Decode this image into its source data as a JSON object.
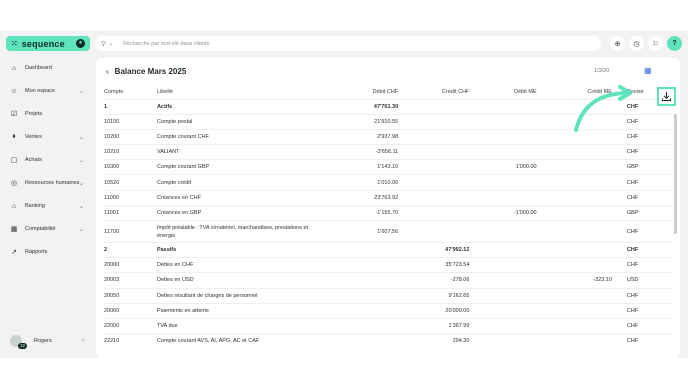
{
  "brand": {
    "name": "sequence",
    "mark": "⁙"
  },
  "search": {
    "placeholder": "Recherche par mot-clé dans clients"
  },
  "sidebar": {
    "items": [
      {
        "label": "Dashboard",
        "icon": "home-icon",
        "glyph": "⌂",
        "chevron": ""
      },
      {
        "label": "Mon espace",
        "icon": "user-icon",
        "glyph": "☺",
        "chevron": "⌄"
      },
      {
        "label": "Projets",
        "icon": "check-square-icon",
        "glyph": "☑",
        "chevron": ""
      },
      {
        "label": "Ventes",
        "icon": "tag-icon",
        "glyph": "⬧",
        "chevron": "⌄"
      },
      {
        "label": "Achats",
        "icon": "bag-icon",
        "glyph": "▢",
        "chevron": "⌄"
      },
      {
        "label": "Ressources humaines",
        "icon": "people-icon",
        "glyph": "◎",
        "chevron": "⌄"
      },
      {
        "label": "Banking",
        "icon": "bank-icon",
        "glyph": "⌂",
        "chevron": "⌄"
      },
      {
        "label": "Comptabilité",
        "icon": "calculator-icon",
        "glyph": "▦",
        "chevron": "⌄"
      },
      {
        "label": "Rapports",
        "icon": "chart-icon",
        "glyph": "↗",
        "chevron": ""
      }
    ],
    "user": {
      "name": "Rogers",
      "badge": "12"
    }
  },
  "page": {
    "title": "Balance Mars 2025",
    "date": "1/3/20"
  },
  "table": {
    "headers": [
      "Compte",
      "Libellé",
      "Débit CHF",
      "Crédit CHF",
      "Débit ME",
      "Crédit ME",
      "Devise"
    ],
    "rows": [
      {
        "compte": "1",
        "libelle": "Actifs",
        "debit_chf": "47'761.30",
        "credit_chf": "",
        "debit_me": "",
        "credit_me": "",
        "devise": "CHF",
        "group": true
      },
      {
        "compte": "10100",
        "libelle": "Compte postal",
        "debit_chf": "21'910.55",
        "credit_chf": "",
        "debit_me": "",
        "credit_me": "",
        "devise": "CHF"
      },
      {
        "compte": "10200",
        "libelle": "Compte courant CHF",
        "debit_chf": "2'937.98",
        "credit_chf": "",
        "debit_me": "",
        "credit_me": "",
        "devise": "CHF"
      },
      {
        "compte": "10210",
        "libelle": "VALIANT",
        "debit_chf": "-3'656.11",
        "credit_chf": "",
        "debit_me": "",
        "credit_me": "",
        "devise": "CHF"
      },
      {
        "compte": "10300",
        "libelle": "Compte courant GBP",
        "debit_chf": "1'143.10",
        "credit_chf": "",
        "debit_me": "1'000.00",
        "credit_me": "",
        "devise": "GBP"
      },
      {
        "compte": "10520",
        "libelle": "Compte crédit",
        "debit_chf": "1'010.00",
        "credit_chf": "",
        "debit_me": "",
        "credit_me": "",
        "devise": "CHF"
      },
      {
        "compte": "11000",
        "libelle": "Créances en CHF",
        "debit_chf": "23'763.92",
        "credit_chf": "",
        "debit_me": "",
        "credit_me": "",
        "devise": "CHF"
      },
      {
        "compte": "11001",
        "libelle": "Créances en GBP",
        "debit_chf": "-1'155.70",
        "credit_chf": "",
        "debit_me": "-1'000.00",
        "credit_me": "",
        "devise": "GBP"
      },
      {
        "compte": "11700",
        "libelle": "Impôt préalable : TVA s/matériel, marchandises, prestations et énergie",
        "debit_chf": "1'607.56",
        "credit_chf": "",
        "debit_me": "",
        "credit_me": "",
        "devise": "CHF",
        "tall": true
      },
      {
        "compte": "2",
        "libelle": "Passifs",
        "debit_chf": "",
        "credit_chf": "47'992.12",
        "debit_me": "",
        "credit_me": "",
        "devise": "CHF",
        "group": true
      },
      {
        "compte": "20000",
        "libelle": "Dettes en CHF",
        "debit_chf": "",
        "credit_chf": "35'723.54",
        "debit_me": "",
        "credit_me": "",
        "devise": "CHF"
      },
      {
        "compte": "20003",
        "libelle": "Dettes en USD",
        "debit_chf": "",
        "credit_chf": "-278.06",
        "debit_me": "",
        "credit_me": "-323.10",
        "devise": "USD"
      },
      {
        "compte": "20050",
        "libelle": "Dettes résultant de charges de personnel",
        "debit_chf": "",
        "credit_chf": "9'162.65",
        "debit_me": "",
        "credit_me": "",
        "devise": "CHF"
      },
      {
        "compte": "20060",
        "libelle": "Paiements en attente",
        "debit_chf": "",
        "credit_chf": "20'000.00",
        "debit_me": "",
        "credit_me": "",
        "devise": "CHF"
      },
      {
        "compte": "22000",
        "libelle": "TVA due",
        "debit_chf": "",
        "credit_chf": "1'367.99",
        "debit_me": "",
        "credit_me": "",
        "devise": "CHF"
      },
      {
        "compte": "22210",
        "libelle": "Compte courant AVS, AI, APG, AC et CAF",
        "debit_chf": "",
        "credit_chf": "294.30",
        "debit_me": "",
        "credit_me": "",
        "devise": "CHF"
      }
    ]
  },
  "colors": {
    "accent": "#5fe3bd",
    "dark": "#0d2c28",
    "background": "#f1f2f1"
  }
}
